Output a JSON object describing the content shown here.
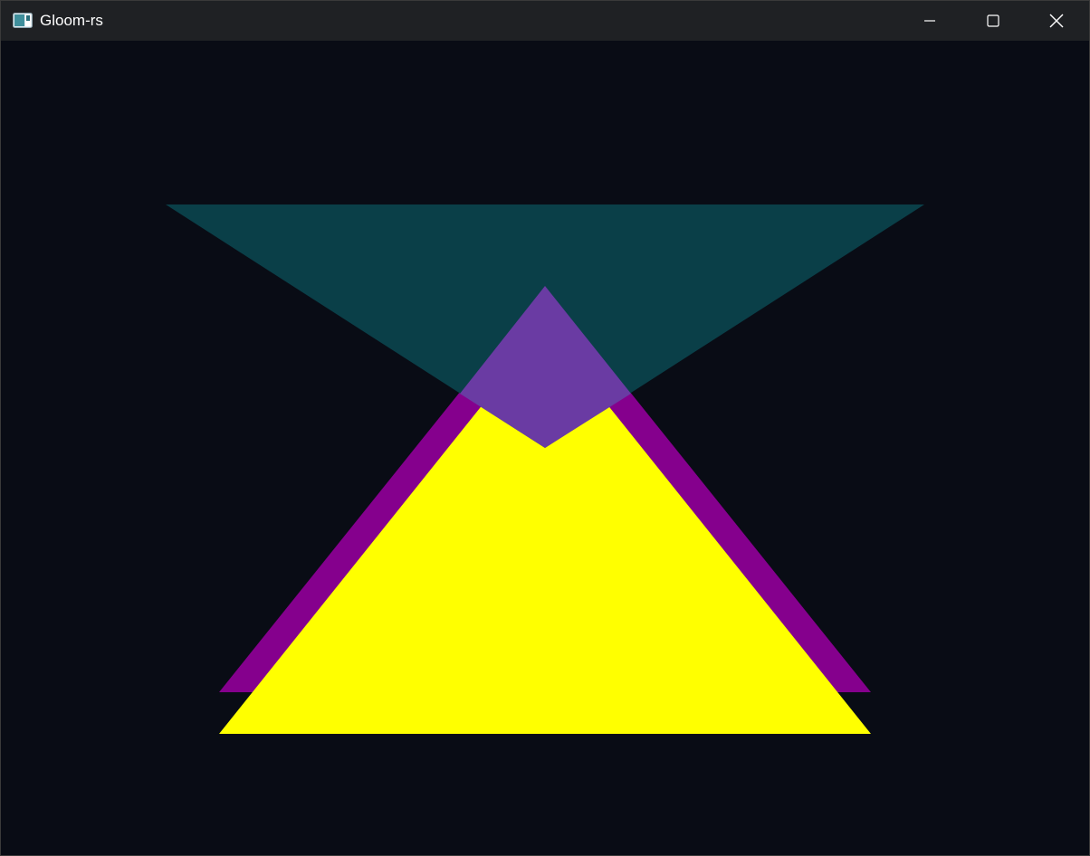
{
  "window": {
    "title": "Gloom-rs",
    "icon": "app-window-icon",
    "controls": {
      "minimize_icon": "minimize-icon",
      "maximize_icon": "maximize-icon",
      "close_icon": "close-icon"
    }
  },
  "scene": {
    "background_color": "#090c15",
    "shapes": [
      {
        "name": "teal-triangle",
        "color": "#0a3f48",
        "blend_color": "#6a3ba3"
      },
      {
        "name": "purple-triangle",
        "color": "#85008d"
      },
      {
        "name": "yellow-triangle",
        "color": "#ffff00"
      }
    ]
  }
}
